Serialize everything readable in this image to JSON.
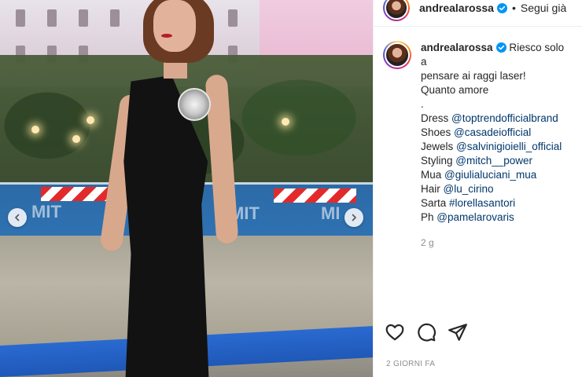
{
  "header": {
    "username": "andrealarossa",
    "separator": "•",
    "follow_label": "Segui già"
  },
  "caption": {
    "username": "andrealarossa",
    "lines": [
      {
        "text": "Riesco solo a"
      },
      {
        "text": "pensare ai raggi laser!"
      },
      {
        "text": "Quanto amore"
      },
      {
        "text": "."
      },
      {
        "prefix": "Dress ",
        "mention": "@toptrendofficialbrand"
      },
      {
        "prefix": "Shoes ",
        "mention": "@casadeiofficial"
      },
      {
        "prefix": "Jewels ",
        "mention": "@salvinigioielli_official"
      },
      {
        "prefix": "Styling ",
        "mention": "@mitch__power"
      },
      {
        "prefix": "Mua ",
        "mention": "@giulialuciani_mua"
      },
      {
        "prefix": "Hair ",
        "mention": "@lu_cirino"
      },
      {
        "prefix": "Sarta ",
        "mention": "#lorellasantori"
      },
      {
        "prefix": "Ph ",
        "mention": "@pamelarovaris"
      }
    ],
    "time_ago": "2 g"
  },
  "footer": {
    "date": "2 GIORNI FA"
  },
  "photo": {
    "barrier_texts": [
      "MIT",
      "MIT",
      "MI"
    ]
  },
  "icons": {
    "like": "heart-icon",
    "comment": "comment-icon",
    "share": "send-icon",
    "verified": "verified-badge-icon",
    "prev": "chevron-left-icon",
    "next": "chevron-right-icon"
  },
  "colors": {
    "verified": "#0095f6",
    "mention": "#00376b",
    "muted": "#8e8e8e"
  }
}
